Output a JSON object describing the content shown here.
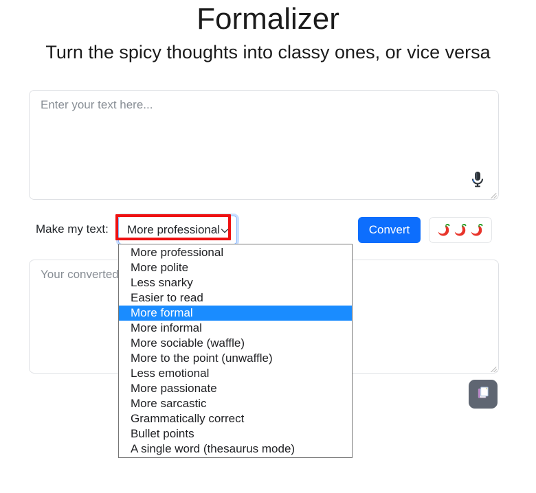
{
  "header": {
    "title": "Formalizer",
    "subtitle": "Turn the spicy thoughts into classy ones, or vice versa"
  },
  "input": {
    "placeholder": "Enter your text here...",
    "value": "",
    "mic_icon": "microphone-icon",
    "resize_handle": "resize-handle"
  },
  "controls": {
    "label": "Make my text:",
    "select": {
      "value": "More professional",
      "expanded": true,
      "chevron_icon": "chevron-down-icon",
      "highlighted_option": "More formal",
      "options": [
        "More professional",
        "More polite",
        "Less snarky",
        "Easier to read",
        "More formal",
        "More informal",
        "More sociable (waffle)",
        "More to the point (unwaffle)",
        "Less emotional",
        "More passionate",
        "More sarcastic",
        "Grammatically correct",
        "Bullet points",
        "A single word (thesaurus mode)"
      ]
    },
    "convert_label": "Convert",
    "spice_button": {
      "name": "spice-level-button",
      "chili_count": 3,
      "icon": "chili-pepper-icon"
    }
  },
  "output": {
    "placeholder": "Your converted text will appear here...",
    "value": "",
    "copy_icon": "copy-icon",
    "resize_handle": "resize-handle"
  },
  "colors": {
    "primary": "#0d6efd",
    "highlight": "#1a8cff",
    "annotation": "#ee1111",
    "copy_button": "#5f6672",
    "chili_red": "#e8342a",
    "chili_stem": "#2aa02a",
    "placeholder": "#888e95",
    "border": "#dfe1e5"
  }
}
